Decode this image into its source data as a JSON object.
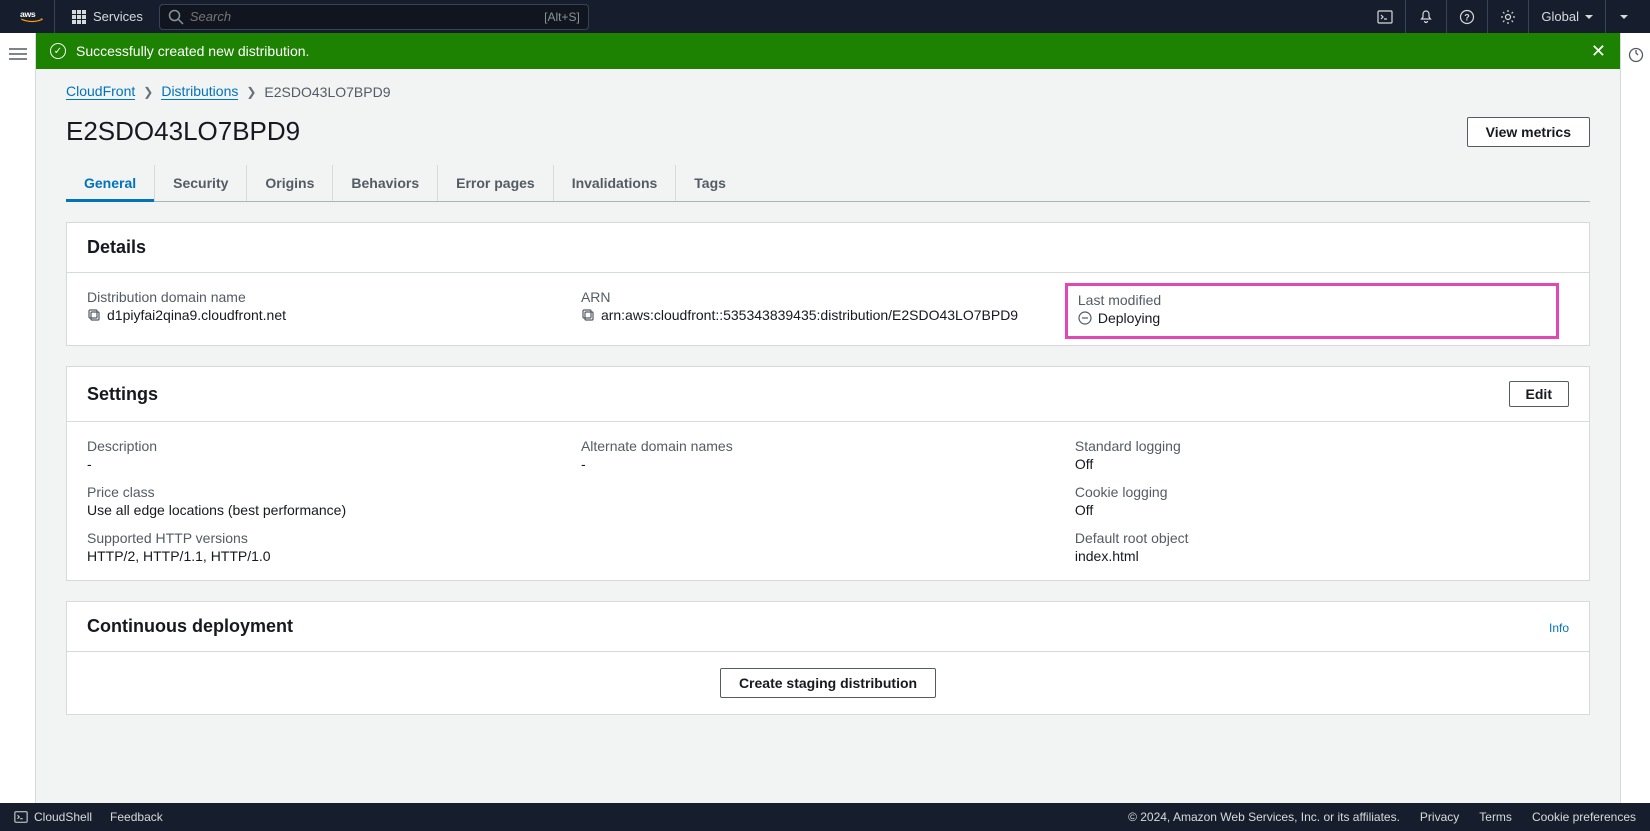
{
  "topnav": {
    "services": "Services",
    "search_placeholder": "Search",
    "search_kbd": "[Alt+S]",
    "region": "Global"
  },
  "flash": {
    "message": "Successfully created new distribution."
  },
  "breadcrumbs": {
    "root": "CloudFront",
    "l2": "Distributions",
    "current": "E2SDO43LO7BPD9"
  },
  "page": {
    "title": "E2SDO43LO7BPD9",
    "view_metrics": "View metrics"
  },
  "tabs": [
    "General",
    "Security",
    "Origins",
    "Behaviors",
    "Error pages",
    "Invalidations",
    "Tags"
  ],
  "details": {
    "heading": "Details",
    "domain_label": "Distribution domain name",
    "domain_value": "d1piyfai2qina9.cloudfront.net",
    "arn_label": "ARN",
    "arn_value": "arn:aws:cloudfront::535343839435:distribution/E2SDO43LO7BPD9",
    "lm_label": "Last modified",
    "lm_value": "Deploying"
  },
  "settings": {
    "heading": "Settings",
    "edit": "Edit",
    "description_label": "Description",
    "description_value": "-",
    "price_label": "Price class",
    "price_value": "Use all edge locations (best performance)",
    "http_label": "Supported HTTP versions",
    "http_value": "HTTP/2, HTTP/1.1, HTTP/1.0",
    "alt_label": "Alternate domain names",
    "alt_value": "-",
    "std_log_label": "Standard logging",
    "std_log_value": "Off",
    "cookie_log_label": "Cookie logging",
    "cookie_log_value": "Off",
    "root_label": "Default root object",
    "root_value": "index.html"
  },
  "cd": {
    "heading": "Continuous deployment",
    "info": "Info",
    "button": "Create staging distribution"
  },
  "footer": {
    "cloudshell": "CloudShell",
    "feedback": "Feedback",
    "copyright": "© 2024, Amazon Web Services, Inc. or its affiliates.",
    "privacy": "Privacy",
    "terms": "Terms",
    "cookie": "Cookie preferences"
  }
}
